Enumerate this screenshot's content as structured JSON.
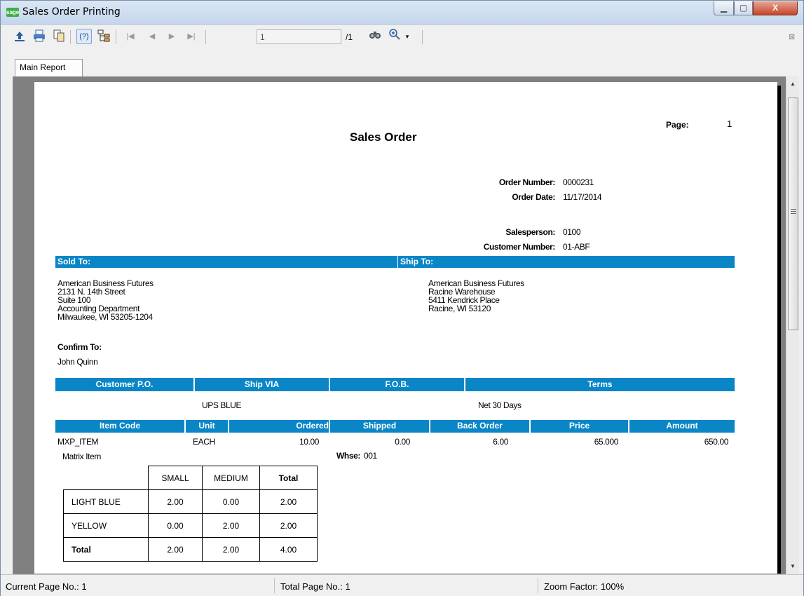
{
  "window": {
    "title": "Sales Order Printing",
    "logo_text": "sage",
    "min_glyph": "▁",
    "max_glyph": "▢",
    "close_glyph": "X"
  },
  "toolbar": {
    "page_value": "1",
    "page_total": "/1",
    "help_glyph": "(?)",
    "close_glyph": "⊠",
    "icons": [
      "export-icon",
      "print-icon",
      "copy-icon",
      "help-icon",
      "group-tree-icon",
      "first-page-icon",
      "previous-page-icon",
      "next-page-icon",
      "last-page-icon",
      "search-icon",
      "zoom-icon"
    ]
  },
  "tab": {
    "label": "Main Report"
  },
  "report": {
    "page_label": "Page:",
    "page_number": "1",
    "title": "Sales Order",
    "order_number_label": "Order Number:",
    "order_number": "0000231",
    "order_date_label": "Order Date:",
    "order_date": "11/17/2014",
    "salesperson_label": "Salesperson:",
    "salesperson": "0100",
    "customer_number_label": "Customer Number:",
    "customer_number": "01-ABF",
    "sold_to_header": "Sold To:",
    "ship_to_header": "Ship To:",
    "sold_to_lines": [
      "American Business Futures",
      "2131 N. 14th Street",
      "Suite 100",
      "Accounting Department",
      "Milwaukee, WI  53205-1204"
    ],
    "ship_to_lines": [
      "American Business Futures",
      "Racine Warehouse",
      "5411 Kendrick Place",
      "Racine, WI  53120"
    ],
    "confirm_to_label": "Confirm To:",
    "confirm_to": "John Quinn",
    "info_headers": [
      "Customer P.O.",
      "Ship VIA",
      "F.O.B.",
      "Terms"
    ],
    "ship_via": "UPS BLUE",
    "terms": "Net 30 Days",
    "item_headers": [
      "Item Code",
      "Unit",
      "Ordered",
      "Shipped",
      "Back Order",
      "Price",
      "Amount"
    ],
    "line_item": {
      "code": "MXP_ITEM",
      "unit": "EACH",
      "ordered": "10.00",
      "shipped": "0.00",
      "back_order": "6.00",
      "price": "65.000",
      "amount": "650.00",
      "description": "Matrix Item",
      "whse_label": "Whse:",
      "whse": "001"
    },
    "matrix": {
      "columns": [
        "SMALL",
        "MEDIUM",
        "Total"
      ],
      "rows": [
        {
          "label": "LIGHT BLUE",
          "values": [
            "2.00",
            "0.00",
            "2.00"
          ]
        },
        {
          "label": "YELLOW",
          "values": [
            "0.00",
            "2.00",
            "2.00"
          ]
        },
        {
          "label": "Total",
          "values": [
            "2.00",
            "2.00",
            "4.00"
          ]
        }
      ]
    }
  },
  "status": {
    "current_page": "Current Page No.: 1",
    "total_page": "Total Page No.: 1",
    "zoom": "Zoom Factor: 100%"
  },
  "colors": {
    "header_bar": "#0a86c7",
    "viewport_bg": "#808080"
  }
}
